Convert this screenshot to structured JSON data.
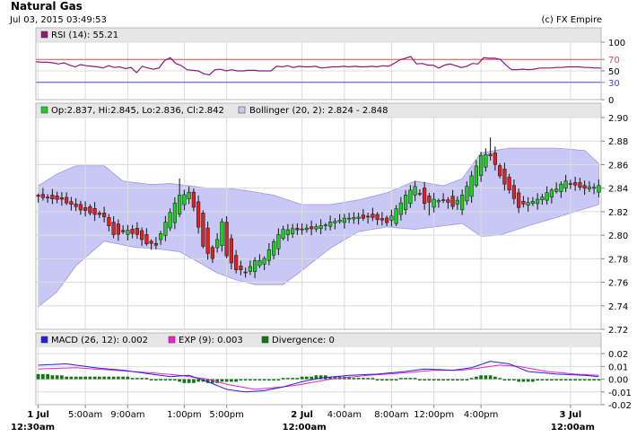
{
  "header": {
    "title": "Natural Gas",
    "timestamp": "Jul 03, 2015 03:49:53",
    "copyright": "(c) FX Empire"
  },
  "colors": {
    "panel_header_bg": "#e6e6e6",
    "grid": "#dcdcdc",
    "up_candle": "#22cc22",
    "down_candle": "#dd2222",
    "rsi_line": "#8b1a7a",
    "rsi_overbought": "#ee4444",
    "rsi_oversold": "#4444ee",
    "bollinger_fill": "#c8c8f4",
    "bollinger_edge": "#9a9ae6",
    "macd_line": "#2222dd",
    "exp_line": "#ee22cc",
    "divergence": "#117711"
  },
  "chart_data": [
    {
      "type": "line",
      "name": "rsi",
      "legend": "RSI (14): 55.21",
      "current": 55.21,
      "ylim": [
        0,
        100
      ],
      "yticks": [
        "100",
        "70",
        "50",
        "30",
        "0"
      ],
      "levels": {
        "overbought": 70,
        "oversold": 30
      },
      "values": [
        66,
        65,
        65,
        64,
        62,
        64,
        60,
        57,
        61,
        59,
        58,
        57,
        55,
        59,
        56,
        57,
        54,
        56,
        47,
        58,
        55,
        53,
        55,
        68,
        73,
        63,
        59,
        52,
        51,
        50,
        45,
        43,
        52,
        53,
        50,
        52,
        50,
        50,
        51,
        51,
        50,
        50,
        50,
        58,
        57,
        59,
        56,
        58,
        57,
        57,
        58,
        55,
        56,
        57,
        57,
        58,
        57,
        58,
        57,
        57,
        58,
        57,
        59,
        58,
        63,
        69,
        72,
        75,
        62,
        63,
        60,
        60,
        55,
        60,
        62,
        59,
        56,
        58,
        63,
        62,
        73,
        72,
        72,
        70,
        60,
        52,
        52,
        53,
        52,
        53,
        55,
        55,
        55,
        56,
        56,
        57,
        57,
        57,
        56,
        56,
        55,
        55
      ]
    },
    {
      "type": "candlestick",
      "name": "price",
      "legend_ohlc": "Op:2.837, Hi:2.845, Lo:2.836, Cl:2.842",
      "legend_bollinger": "Bollinger (20, 2): 2.824 - 2.848",
      "ylim": [
        2.72,
        2.9
      ],
      "yticks": [
        "2.90",
        "2.88",
        "2.86",
        "2.84",
        "2.82",
        "2.80",
        "2.78",
        "2.76",
        "2.74",
        "2.72"
      ],
      "x_labels": [
        {
          "i": 0,
          "text": "1 Jul",
          "sub": "12:30am"
        },
        {
          "i": 10,
          "text": "5:00am"
        },
        {
          "i": 19,
          "text": "9:00am"
        },
        {
          "i": 31,
          "text": "1:00pm"
        },
        {
          "i": 40,
          "text": "5:00pm"
        },
        {
          "i": 56,
          "text": "2 Jul",
          "sub": "12:00am"
        },
        {
          "i": 65,
          "text": "4:00am"
        },
        {
          "i": 75,
          "text": "8:00am"
        },
        {
          "i": 84,
          "text": "12:00pm"
        },
        {
          "i": 94,
          "text": "4:00pm"
        },
        {
          "i": 113,
          "text": "3 Jul",
          "sub": "12:00am"
        }
      ],
      "n": 120,
      "key": [
        [
          0,
          2.834,
          2.833
        ],
        [
          5,
          2.833,
          2.83
        ],
        [
          9,
          2.825,
          2.822
        ],
        [
          11,
          2.824,
          2.819
        ],
        [
          14,
          2.818,
          2.816
        ],
        [
          16,
          2.812,
          2.8
        ],
        [
          19,
          2.801,
          2.804
        ],
        [
          21,
          2.807,
          2.8
        ],
        [
          23,
          2.8,
          2.793
        ],
        [
          25,
          2.792,
          2.792
        ],
        [
          28,
          2.805,
          2.82
        ],
        [
          30,
          2.818,
          2.834
        ],
        [
          32,
          2.832,
          2.836
        ],
        [
          33,
          2.836,
          2.824
        ],
        [
          35,
          2.82,
          2.79
        ],
        [
          37,
          2.79,
          2.78
        ],
        [
          39,
          2.79,
          2.812
        ],
        [
          40,
          2.812,
          2.782
        ],
        [
          42,
          2.782,
          2.771
        ],
        [
          44,
          2.768,
          2.769
        ],
        [
          46,
          2.77,
          2.778
        ],
        [
          48,
          2.776,
          2.78
        ],
        [
          50,
          2.782,
          2.795
        ],
        [
          52,
          2.797,
          2.805
        ],
        [
          55,
          2.805,
          2.805
        ],
        [
          58,
          2.806,
          2.806
        ],
        [
          60,
          2.806,
          2.808
        ],
        [
          63,
          2.81,
          2.812
        ],
        [
          66,
          2.813,
          2.815
        ],
        [
          69,
          2.816,
          2.815
        ],
        [
          71,
          2.818,
          2.815
        ],
        [
          74,
          2.814,
          2.811
        ],
        [
          76,
          2.811,
          2.822
        ],
        [
          78,
          2.822,
          2.834
        ],
        [
          80,
          2.833,
          2.842
        ],
        [
          82,
          2.84,
          2.827
        ],
        [
          84,
          2.825,
          2.83
        ],
        [
          86,
          2.83,
          2.83
        ],
        [
          88,
          2.832,
          2.825
        ],
        [
          90,
          2.822,
          2.834
        ],
        [
          92,
          2.834,
          2.85
        ],
        [
          94,
          2.85,
          2.868
        ],
        [
          96,
          2.868,
          2.868
        ],
        [
          97,
          2.87,
          2.86
        ],
        [
          98,
          2.86,
          2.85
        ],
        [
          100,
          2.85,
          2.838
        ],
        [
          102,
          2.835,
          2.824
        ],
        [
          104,
          2.825,
          2.828
        ],
        [
          106,
          2.828,
          2.83
        ],
        [
          108,
          2.83,
          2.836
        ],
        [
          110,
          2.836,
          2.84
        ],
        [
          112,
          2.84,
          2.846
        ],
        [
          114,
          2.846,
          2.842
        ],
        [
          116,
          2.842,
          2.84
        ],
        [
          119,
          2.837,
          2.842
        ]
      ],
      "bollinger_upper": [
        [
          0,
          2.842
        ],
        [
          4,
          2.852
        ],
        [
          8,
          2.859
        ],
        [
          14,
          2.859
        ],
        [
          18,
          2.846
        ],
        [
          24,
          2.843
        ],
        [
          28,
          2.844
        ],
        [
          32,
          2.842
        ],
        [
          36,
          2.84
        ],
        [
          40,
          2.84
        ],
        [
          44,
          2.838
        ],
        [
          50,
          2.834
        ],
        [
          56,
          2.826
        ],
        [
          62,
          2.826
        ],
        [
          68,
          2.83
        ],
        [
          74,
          2.836
        ],
        [
          80,
          2.846
        ],
        [
          86,
          2.842
        ],
        [
          90,
          2.848
        ],
        [
          94,
          2.87
        ],
        [
          100,
          2.874
        ],
        [
          110,
          2.874
        ],
        [
          116,
          2.872
        ],
        [
          119,
          2.861
        ]
      ],
      "bollinger_lower": [
        [
          0,
          2.739
        ],
        [
          4,
          2.752
        ],
        [
          8,
          2.774
        ],
        [
          14,
          2.795
        ],
        [
          20,
          2.79
        ],
        [
          26,
          2.788
        ],
        [
          30,
          2.786
        ],
        [
          34,
          2.777
        ],
        [
          38,
          2.768
        ],
        [
          42,
          2.762
        ],
        [
          46,
          2.758
        ],
        [
          52,
          2.758
        ],
        [
          56,
          2.77
        ],
        [
          62,
          2.789
        ],
        [
          68,
          2.803
        ],
        [
          74,
          2.807
        ],
        [
          80,
          2.805
        ],
        [
          86,
          2.808
        ],
        [
          90,
          2.81
        ],
        [
          94,
          2.799
        ],
        [
          98,
          2.8
        ],
        [
          104,
          2.808
        ],
        [
          110,
          2.815
        ],
        [
          114,
          2.82
        ],
        [
          119,
          2.826
        ]
      ]
    },
    {
      "type": "line",
      "name": "macd",
      "legend_macd": "MACD (26, 12): 0.002",
      "legend_exp": "EXP (9): 0.003",
      "legend_div": "Divergence: 0",
      "ylim": [
        -0.02,
        0.025
      ],
      "yticks": [
        "0.02",
        "0.01",
        "0.00",
        "-0.01",
        "-0.02"
      ],
      "macd": [
        [
          0,
          0.011
        ],
        [
          6,
          0.012
        ],
        [
          12,
          0.009
        ],
        [
          18,
          0.007
        ],
        [
          24,
          0.004
        ],
        [
          28,
          0.002
        ],
        [
          32,
          0.003
        ],
        [
          36,
          -0.002
        ],
        [
          40,
          -0.008
        ],
        [
          44,
          -0.01
        ],
        [
          48,
          -0.009
        ],
        [
          52,
          -0.006
        ],
        [
          56,
          -0.002
        ],
        [
          60,
          0.001
        ],
        [
          66,
          0.003
        ],
        [
          72,
          0.004
        ],
        [
          78,
          0.006
        ],
        [
          82,
          0.008
        ],
        [
          88,
          0.007
        ],
        [
          92,
          0.009
        ],
        [
          96,
          0.014
        ],
        [
          100,
          0.012
        ],
        [
          104,
          0.006
        ],
        [
          110,
          0.004
        ],
        [
          116,
          0.003
        ],
        [
          119,
          0.002
        ]
      ],
      "exp": [
        [
          0,
          0.008
        ],
        [
          8,
          0.009
        ],
        [
          16,
          0.007
        ],
        [
          24,
          0.005
        ],
        [
          30,
          0.003
        ],
        [
          36,
          0.0
        ],
        [
          40,
          -0.004
        ],
        [
          46,
          -0.008
        ],
        [
          52,
          -0.006
        ],
        [
          56,
          -0.004
        ],
        [
          62,
          0.0
        ],
        [
          70,
          0.003
        ],
        [
          78,
          0.005
        ],
        [
          84,
          0.007
        ],
        [
          90,
          0.007
        ],
        [
          94,
          0.009
        ],
        [
          98,
          0.011
        ],
        [
          102,
          0.01
        ],
        [
          108,
          0.006
        ],
        [
          114,
          0.004
        ],
        [
          119,
          0.003
        ]
      ],
      "divergence": [
        0.004,
        0.004,
        0.004,
        0.003,
        0.003,
        0.003,
        0.002,
        0.002,
        0.002,
        0.002,
        0.002,
        0.002,
        0.002,
        0.002,
        0.002,
        0.002,
        0.002,
        0.002,
        0.002,
        0.002,
        0.001,
        0.001,
        0.001,
        0.001,
        0.0,
        0.0,
        0.0,
        0.0,
        -0.001,
        -0.001,
        -0.002,
        -0.003,
        -0.003,
        -0.003,
        -0.002,
        -0.002,
        -0.003,
        -0.003,
        -0.003,
        -0.002,
        -0.002,
        -0.002,
        -0.002,
        -0.001,
        -0.001,
        -0.001,
        -0.001,
        -0.001,
        -0.001,
        -0.001,
        0.0,
        0.0,
        0.001,
        0.001,
        0.001,
        0.001,
        0.002,
        0.002,
        0.002,
        0.003,
        0.003,
        0.003,
        0.002,
        0.002,
        0.002,
        0.002,
        0.002,
        0.001,
        0.001,
        0.001,
        0.001,
        0.001,
        0.0,
        0.0,
        0.0,
        0.0,
        0.0,
        0.001,
        0.001,
        0.001,
        0.001,
        0.0,
        0.0,
        0.0,
        0.0,
        -0.001,
        -0.001,
        -0.001,
        -0.001,
        -0.001,
        0.0,
        0.0,
        0.001,
        0.002,
        0.003,
        0.003,
        0.003,
        0.002,
        0.001,
        0.0,
        -0.001,
        -0.001,
        -0.002,
        -0.002,
        -0.002,
        -0.002,
        -0.001,
        -0.001,
        -0.001,
        -0.001,
        -0.001,
        -0.001,
        -0.001,
        -0.001,
        -0.001,
        0.0,
        0.0,
        0.0,
        0.0,
        0.0
      ]
    }
  ]
}
